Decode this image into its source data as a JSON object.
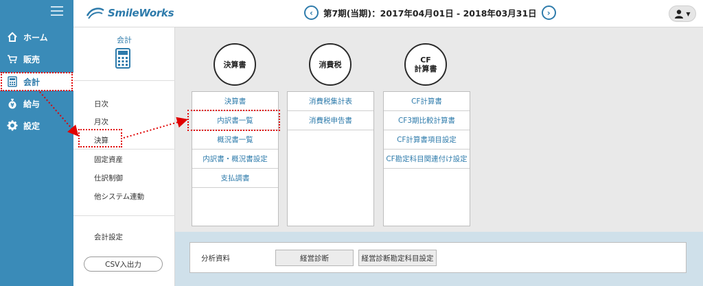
{
  "app": {
    "logo": "SmileWorks"
  },
  "header": {
    "period": "第7期(当期)：2017年04月01日 - 2018年03月31日",
    "prev_icon": "chevron-left-icon",
    "next_icon": "chevron-right-icon"
  },
  "nav": {
    "items": [
      {
        "label": "ホーム",
        "icon": "home-icon"
      },
      {
        "label": "販売",
        "icon": "cart-icon"
      },
      {
        "label": "会計",
        "icon": "calculator-icon"
      },
      {
        "label": "給与",
        "icon": "money-bag-icon"
      },
      {
        "label": "設定",
        "icon": "gear-icon"
      }
    ],
    "active_index": 2
  },
  "subnav": {
    "title": "会計",
    "items": [
      "日次",
      "月次",
      "決算",
      "固定資産",
      "仕訳制御",
      "他システム連動"
    ],
    "settings": "会計設定",
    "csv_button": "CSV入出力"
  },
  "main": {
    "groups": [
      {
        "title": "決算書",
        "items": [
          "決算書",
          "内訳書一覧",
          "概況書一覧",
          "内訳書・概況書設定",
          "支払調書"
        ]
      },
      {
        "title": "消費税",
        "items": [
          "消費税集計表",
          "消費税申告書"
        ]
      },
      {
        "title_line1": "CF",
        "title_line2": "計算書",
        "items": [
          "CF計算書",
          "CF3期比較計算書",
          "CF計算書項目設定",
          "CF勘定科目関連付け設定"
        ]
      }
    ],
    "analysis": {
      "label": "分析資料",
      "button1": "経営診断",
      "button2": "経営診断勘定科目設定"
    }
  },
  "colors": {
    "nav_bg": "#3a8bb8",
    "accent": "#2e7bab",
    "highlight": "#e00000"
  }
}
